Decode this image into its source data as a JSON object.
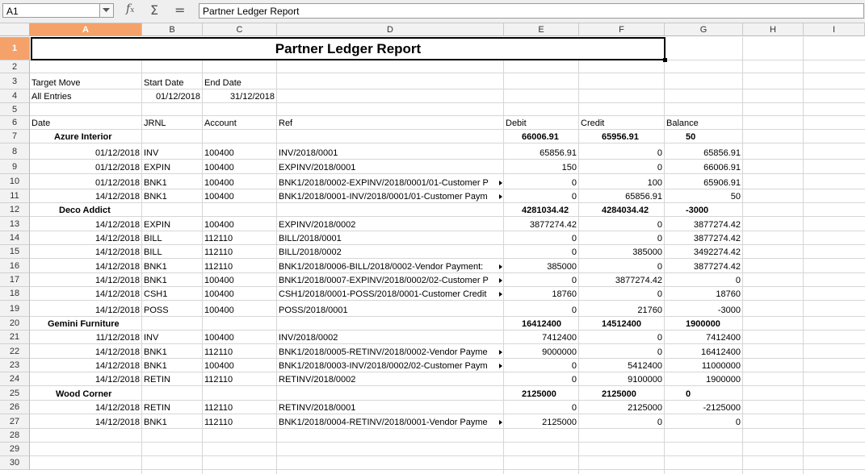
{
  "toolbar": {
    "cell_ref": "A1",
    "formula": "Partner Ledger Report",
    "fx_label": "f",
    "fx_sub": "x",
    "sum_label": "Σ",
    "eq_label": "="
  },
  "columns": [
    "A",
    "B",
    "C",
    "D",
    "E",
    "F",
    "G",
    "H",
    "I"
  ],
  "rows": [
    "1",
    "2",
    "3",
    "4",
    "5",
    "6",
    "7",
    "8",
    "9",
    "10",
    "11",
    "12",
    "13",
    "14",
    "15",
    "16",
    "17",
    "18",
    "19",
    "20",
    "21",
    "22",
    "23",
    "24",
    "25",
    "26",
    "27",
    "28",
    "29",
    "30"
  ],
  "report": {
    "title": "Partner Ledger Report",
    "target_move_label": "Target Move",
    "start_date_label": "Start Date",
    "end_date_label": "End Date",
    "target_move_value": "All Entries",
    "start_date_value": "01/12/2018",
    "end_date_value": "31/12/2018",
    "headers": {
      "date": "Date",
      "jrnl": "JRNL",
      "account": "Account",
      "ref": "Ref",
      "debit": "Debit",
      "credit": "Credit",
      "balance": "Balance"
    }
  },
  "partners": [
    {
      "name": "Azure Interior",
      "debit": "66006.91",
      "credit": "65956.91",
      "balance": "50",
      "lines": [
        {
          "date": "01/12/2018",
          "jrnl": "INV",
          "account": "100400",
          "ref": "INV/2018/0001",
          "debit": "65856.91",
          "credit": "0",
          "balance": "65856.91",
          "cut": false
        },
        {
          "date": "01/12/2018",
          "jrnl": "EXPIN",
          "account": "100400",
          "ref": "EXPINV/2018/0001",
          "debit": "150",
          "credit": "0",
          "balance": "66006.91",
          "cut": false
        },
        {
          "date": "01/12/2018",
          "jrnl": "BNK1",
          "account": "100400",
          "ref": "BNK1/2018/0002-EXPINV/2018/0001/01-Customer P",
          "debit": "0",
          "credit": "100",
          "balance": "65906.91",
          "cut": true
        },
        {
          "date": "14/12/2018",
          "jrnl": "BNK1",
          "account": "100400",
          "ref": "BNK1/2018/0001-INV/2018/0001/01-Customer Paym",
          "debit": "0",
          "credit": "65856.91",
          "balance": "50",
          "cut": true
        }
      ]
    },
    {
      "name": "Deco Addict",
      "debit": "4281034.42",
      "credit": "4284034.42",
      "balance": "-3000",
      "lines": [
        {
          "date": "14/12/2018",
          "jrnl": "EXPIN",
          "account": "100400",
          "ref": "EXPINV/2018/0002",
          "debit": "3877274.42",
          "credit": "0",
          "balance": "3877274.42",
          "cut": false
        },
        {
          "date": "14/12/2018",
          "jrnl": "BILL",
          "account": "112110",
          "ref": "BILL/2018/0001",
          "debit": "0",
          "credit": "0",
          "balance": "3877274.42",
          "cut": false
        },
        {
          "date": "14/12/2018",
          "jrnl": "BILL",
          "account": "112110",
          "ref": "BILL/2018/0002",
          "debit": "0",
          "credit": "385000",
          "balance": "3492274.42",
          "cut": false
        },
        {
          "date": "14/12/2018",
          "jrnl": "BNK1",
          "account": "112110",
          "ref": "BNK1/2018/0006-BILL/2018/0002-Vendor Payment: ",
          "debit": "385000",
          "credit": "0",
          "balance": "3877274.42",
          "cut": true
        },
        {
          "date": "14/12/2018",
          "jrnl": "BNK1",
          "account": "100400",
          "ref": "BNK1/2018/0007-EXPINV/2018/0002/02-Customer P",
          "debit": "0",
          "credit": "3877274.42",
          "balance": "0",
          "cut": true
        },
        {
          "date": "14/12/2018",
          "jrnl": "CSH1",
          "account": "100400",
          "ref": "CSH1/2018/0001-POSS/2018/0001-Customer Credit",
          "debit": "18760",
          "credit": "0",
          "balance": "18760",
          "cut": true
        },
        {
          "date": "14/12/2018",
          "jrnl": "POSS",
          "account": "100400",
          "ref": "POSS/2018/0001",
          "debit": "0",
          "credit": "21760",
          "balance": "-3000",
          "cut": false
        }
      ]
    },
    {
      "name": "Gemini Furniture",
      "debit": "16412400",
      "credit": "14512400",
      "balance": "1900000",
      "lines": [
        {
          "date": "11/12/2018",
          "jrnl": "INV",
          "account": "100400",
          "ref": "INV/2018/0002",
          "debit": "7412400",
          "credit": "0",
          "balance": "7412400",
          "cut": false
        },
        {
          "date": "14/12/2018",
          "jrnl": "BNK1",
          "account": "112110",
          "ref": "BNK1/2018/0005-RETINV/2018/0002-Vendor Payme",
          "debit": "9000000",
          "credit": "0",
          "balance": "16412400",
          "cut": true
        },
        {
          "date": "14/12/2018",
          "jrnl": "BNK1",
          "account": "100400",
          "ref": "BNK1/2018/0003-INV/2018/0002/02-Customer Paym",
          "debit": "0",
          "credit": "5412400",
          "balance": "11000000",
          "cut": true
        },
        {
          "date": "14/12/2018",
          "jrnl": "RETIN",
          "account": "112110",
          "ref": "RETINV/2018/0002",
          "debit": "0",
          "credit": "9100000",
          "balance": "1900000",
          "cut": false
        }
      ]
    },
    {
      "name": "Wood Corner",
      "debit": "2125000",
      "credit": "2125000",
      "balance": "0",
      "lines": [
        {
          "date": "14/12/2018",
          "jrnl": "RETIN",
          "account": "112110",
          "ref": "RETINV/2018/0001",
          "debit": "0",
          "credit": "2125000",
          "balance": "-2125000",
          "cut": false
        },
        {
          "date": "14/12/2018",
          "jrnl": "BNK1",
          "account": "112110",
          "ref": "BNK1/2018/0004-RETINV/2018/0001-Vendor Payme",
          "debit": "2125000",
          "credit": "0",
          "balance": "0",
          "cut": true
        }
      ]
    }
  ]
}
